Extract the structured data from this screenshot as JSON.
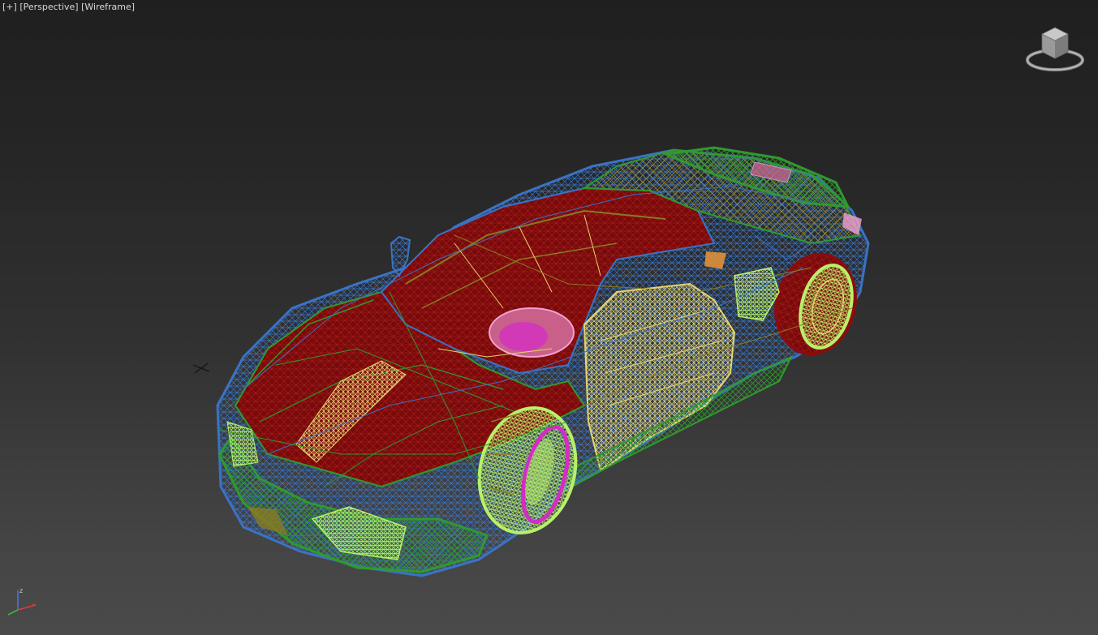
{
  "viewport": {
    "menu_label": "[+]",
    "view_label": "[Perspective]",
    "shading_label": "[Wireframe]",
    "background_colors": [
      "#1f1f1f",
      "#4a4a4a"
    ]
  },
  "viewcube": {
    "icon": "viewcube-icon"
  },
  "axis_tripod": {
    "z_label": "z",
    "colors": {
      "x": "#e03a3a",
      "y": "#3ac83a",
      "z": "#4a78e8"
    }
  },
  "model": {
    "name_icon": "car-wireframe",
    "wire_colors": {
      "body": "#3a73c4",
      "green": "#2f9a2f",
      "red": "#8a0c0c",
      "yellow": "#e4d46e",
      "lime": "#b8f06a",
      "magenta": "#d42cc4",
      "olive": "#8a7a22",
      "pink": "#f2a0d0"
    }
  }
}
